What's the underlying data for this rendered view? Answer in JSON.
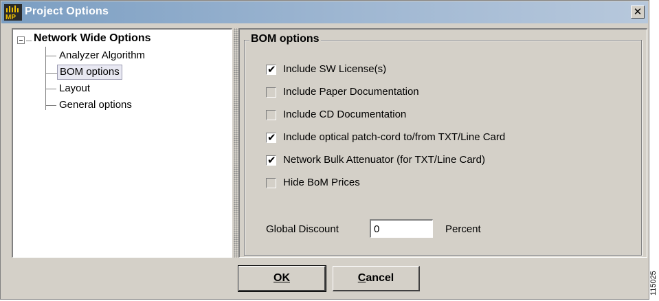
{
  "window": {
    "title": "Project Options",
    "icon": "mp-app-icon",
    "close_label": "✕"
  },
  "tree": {
    "root_label": "Network Wide Options",
    "expander": "−",
    "items": [
      {
        "label": "Analyzer Algorithm",
        "selected": false
      },
      {
        "label": "BOM options",
        "selected": true
      },
      {
        "label": "Layout",
        "selected": false
      },
      {
        "label": "General options",
        "selected": false
      }
    ]
  },
  "bom": {
    "group_title": "BOM options",
    "options": [
      {
        "label": "Include SW License(s)",
        "checked": true
      },
      {
        "label": "Include Paper Documentation",
        "checked": false
      },
      {
        "label": "Include CD Documentation",
        "checked": false
      },
      {
        "label": "Include optical patch-cord to/from TXT/Line Card",
        "checked": true
      },
      {
        "label": "Network Bulk Attenuator (for TXT/Line Card)",
        "checked": true
      },
      {
        "label": "Hide BoM Prices",
        "checked": false
      }
    ],
    "check_glyph": "✔",
    "discount_label": "Global Discount",
    "discount_value": "0",
    "percent_label": "Percent"
  },
  "buttons": {
    "ok": "OK",
    "cancel": "Cancel"
  },
  "figure_id": "115025",
  "colors": {
    "title_bar_start": "#7b9ec2",
    "title_bar_end": "#b7c8dc",
    "panel_bg": "#d4d0c8",
    "selection_bg": "#e8e8f2"
  }
}
